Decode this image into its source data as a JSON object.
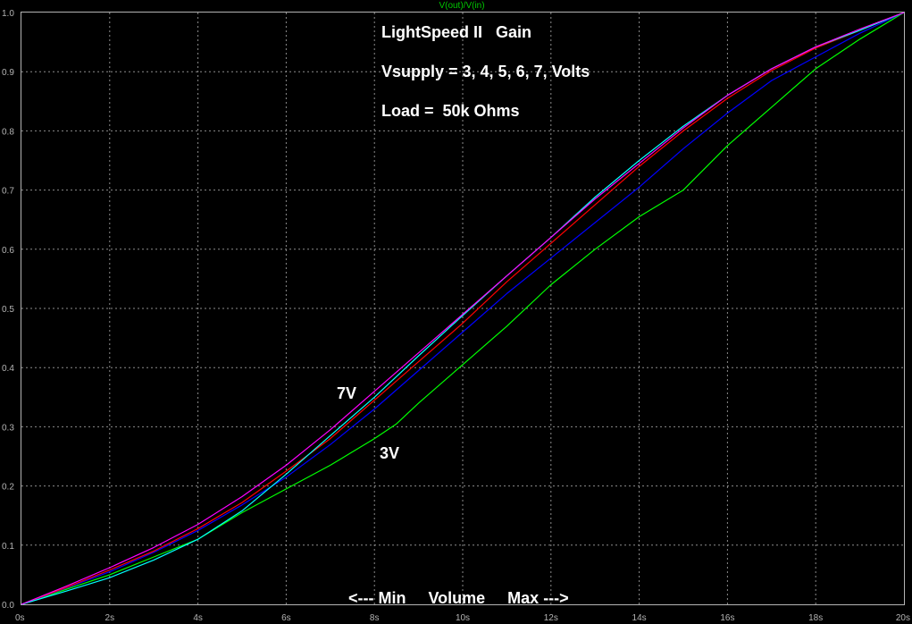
{
  "chart_data": {
    "type": "line",
    "trace_label": "V(out)/V(in)",
    "x_unit": "s",
    "xlim": [
      0,
      20
    ],
    "ylim": [
      0,
      1.0
    ],
    "x_ticks": [
      "0s",
      "2s",
      "4s",
      "6s",
      "8s",
      "10s",
      "12s",
      "14s",
      "16s",
      "18s",
      "20s"
    ],
    "y_ticks": [
      "0.0",
      "0.1",
      "0.2",
      "0.3",
      "0.4",
      "0.5",
      "0.6",
      "0.7",
      "0.8",
      "0.9",
      "1.0"
    ],
    "grid": true,
    "annotations": {
      "title": "LightSpeed II   Gain",
      "supply": "Vsupply = 3, 4, 5, 6, 7, Volts",
      "load": "Load =  50k Ohms",
      "label_7v": "7V",
      "label_3v": "3V",
      "volume": "<--- Min     Volume     Max --->"
    },
    "series": [
      {
        "color": "#00ff00",
        "x": [
          0,
          1,
          2,
          3,
          4,
          5,
          6,
          7,
          8,
          8.5,
          9,
          10,
          11,
          12,
          13,
          14,
          15,
          16,
          17,
          18,
          19,
          20
        ],
        "y": [
          0,
          0.025,
          0.05,
          0.08,
          0.11,
          0.155,
          0.195,
          0.235,
          0.28,
          0.305,
          0.34,
          0.405,
          0.47,
          0.54,
          0.6,
          0.655,
          0.7,
          0.775,
          0.84,
          0.905,
          0.955,
          1.0
        ]
      },
      {
        "color": "#0000ff",
        "x": [
          0,
          1,
          2,
          3,
          4,
          5,
          6,
          7,
          8,
          9,
          10,
          11,
          12,
          13,
          14,
          15,
          16,
          17,
          18,
          19,
          20
        ],
        "y": [
          0,
          0.027,
          0.055,
          0.088,
          0.125,
          0.168,
          0.215,
          0.27,
          0.33,
          0.395,
          0.46,
          0.525,
          0.585,
          0.645,
          0.705,
          0.77,
          0.83,
          0.885,
          0.925,
          0.965,
          1.0
        ]
      },
      {
        "color": "#ff0000",
        "x": [
          0,
          1,
          2,
          3,
          4,
          5,
          6,
          7,
          8,
          9,
          10,
          11,
          12,
          13,
          14,
          15,
          16,
          17,
          18,
          19,
          20
        ],
        "y": [
          0,
          0.028,
          0.058,
          0.09,
          0.128,
          0.172,
          0.225,
          0.28,
          0.345,
          0.41,
          0.475,
          0.545,
          0.61,
          0.675,
          0.74,
          0.8,
          0.855,
          0.902,
          0.94,
          0.97,
          1.0
        ]
      },
      {
        "color": "#00ffff",
        "x": [
          0,
          1,
          2,
          3,
          4,
          5,
          6,
          7,
          8,
          9,
          10,
          11,
          12,
          13,
          14,
          15,
          16,
          17,
          18,
          19,
          20
        ],
        "y": [
          0,
          0.022,
          0.045,
          0.075,
          0.11,
          0.158,
          0.22,
          0.285,
          0.35,
          0.42,
          0.488,
          0.555,
          0.62,
          0.688,
          0.75,
          0.808,
          0.86,
          0.905,
          0.942,
          0.97,
          1.0
        ]
      },
      {
        "color": "#ff00ff",
        "x": [
          0,
          1,
          2,
          3,
          4,
          5,
          6,
          7,
          8,
          9,
          10,
          11,
          12,
          13,
          14,
          15,
          16,
          17,
          18,
          19,
          20
        ],
        "y": [
          0,
          0.03,
          0.062,
          0.096,
          0.135,
          0.182,
          0.235,
          0.295,
          0.36,
          0.425,
          0.49,
          0.555,
          0.62,
          0.685,
          0.745,
          0.805,
          0.86,
          0.905,
          0.942,
          0.972,
          1.0
        ]
      }
    ]
  }
}
